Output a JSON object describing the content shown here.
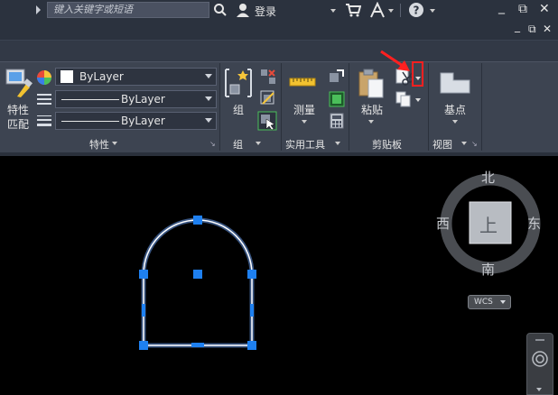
{
  "titlebar": {
    "search_placeholder": "键入关键字或短语",
    "login_label": "登录",
    "minimize": "_",
    "restore": "⧉",
    "close": "✕"
  },
  "ribbon": {
    "properties": {
      "match_label_1": "特性",
      "match_label_2": "匹配",
      "color_combo": "ByLayer",
      "linetype_combo": "ByLayer",
      "lineweight_combo": "ByLayer",
      "panel_title": "特性"
    },
    "group": {
      "button_label": "组",
      "panel_title": "组"
    },
    "utilities": {
      "measure_label": "测量",
      "panel_title": "实用工具"
    },
    "clipboard": {
      "paste_label": "粘贴",
      "panel_title": "剪贴板"
    },
    "view": {
      "basepoint_label": "基点",
      "panel_title": "视图"
    }
  },
  "viewcube": {
    "north": "北",
    "south": "南",
    "east": "东",
    "west": "西",
    "face": "上",
    "wcs": "WCS"
  },
  "colors": {
    "accent": "#1e80f0",
    "ribbon_bg": "#3d4451",
    "annotation": "#ff2020"
  }
}
